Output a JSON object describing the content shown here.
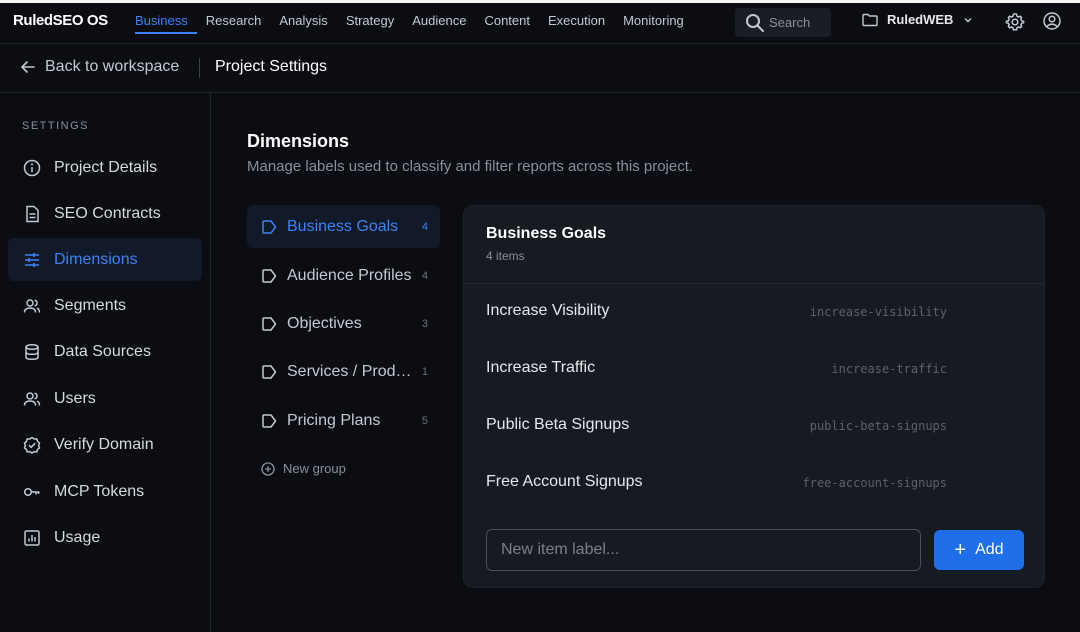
{
  "brand": "RuledSEO OS",
  "nav": {
    "links": [
      "Business",
      "Research",
      "Analysis",
      "Strategy",
      "Audience",
      "Content",
      "Execution",
      "Monitoring"
    ],
    "active": "Business",
    "search_placeholder": "Search",
    "workspace": "RuledWEB"
  },
  "subheader": {
    "back_label": "Back to workspace",
    "page_title": "Project Settings"
  },
  "sidebar": {
    "heading": "SETTINGS",
    "items": [
      {
        "label": "Project Details",
        "icon": "info-icon"
      },
      {
        "label": "SEO Contracts",
        "icon": "document-icon"
      },
      {
        "label": "Dimensions",
        "icon": "sliders-icon",
        "active": true
      },
      {
        "label": "Segments",
        "icon": "users-icon"
      },
      {
        "label": "Data Sources",
        "icon": "database-icon"
      },
      {
        "label": "Users",
        "icon": "users-icon"
      },
      {
        "label": "Verify Domain",
        "icon": "badge-check-icon"
      },
      {
        "label": "MCP Tokens",
        "icon": "key-icon"
      },
      {
        "label": "Usage",
        "icon": "chart-icon"
      }
    ]
  },
  "main": {
    "title": "Dimensions",
    "subtitle": "Manage labels used to classify and filter reports across this project.",
    "groups": [
      {
        "label": "Business Goals",
        "count": "4",
        "active": true
      },
      {
        "label": "Audience Profiles",
        "count": "4"
      },
      {
        "label": "Objectives",
        "count": "3"
      },
      {
        "label": "Services / Products",
        "count": "1"
      },
      {
        "label": "Pricing Plans",
        "count": "5"
      }
    ],
    "new_group_label": "New group",
    "panel": {
      "title": "Business Goals",
      "count_label": "4 items",
      "items": [
        {
          "label": "Increase Visibility",
          "slug": "increase-visibility"
        },
        {
          "label": "Increase Traffic",
          "slug": "increase-traffic"
        },
        {
          "label": "Public Beta Signups",
          "slug": "public-beta-signups"
        },
        {
          "label": "Free Account Signups",
          "slug": "free-account-signups"
        }
      ],
      "new_item_placeholder": "New item label...",
      "add_label": "Add"
    }
  },
  "colors": {
    "accent": "#3b82f6",
    "button": "#1f6feb",
    "background": "#0b0d12",
    "panel": "#161a21"
  }
}
